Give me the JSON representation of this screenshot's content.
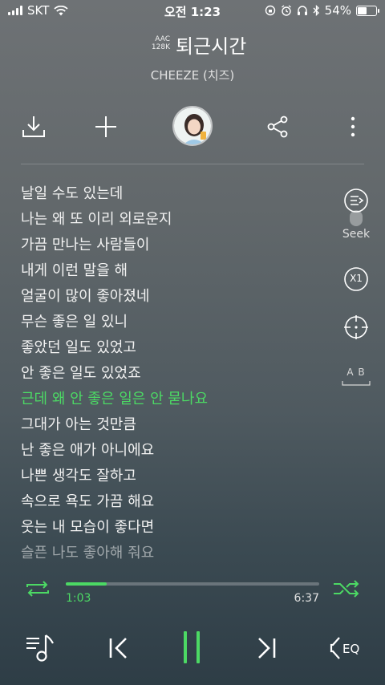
{
  "status_bar": {
    "carrier": "SKT",
    "time": "오전 1:23",
    "battery": "54%",
    "battery_level": 0.54
  },
  "header": {
    "quality_codec": "AAC",
    "quality_bitrate": "128K",
    "title": "퇴근시간",
    "artist": "CHEEZE (치즈)"
  },
  "actions": {
    "download_icon": "download-icon",
    "add_icon": "plus-icon",
    "share_icon": "share-icon",
    "more_icon": "more-vertical-icon"
  },
  "lyrics": [
    "날일 수도 있는데",
    "나는 왜 또 이리 외로운지",
    "가끔 만나는 사람들이",
    "내게 이런 말을 해",
    "얼굴이 많이 좋아졌네",
    "무슨 좋은 일 있니",
    "좋았던 일도 있었고",
    "안 좋은 일도 있었죠",
    "근데 왜 안 좋은 일은 안 묻나요",
    "그대가 아는 것만큼",
    "난 좋은 애가 아니에요",
    "나쁜 생각도 잘하고",
    "속으로 욕도 가끔 해요",
    "웃는 내 모습이 좋다면",
    "슬픈 나도 좋아해 줘요"
  ],
  "current_lyric_index": 8,
  "tools": {
    "seek_label": "Seek",
    "speed_label": "X1",
    "ab_label": "A B"
  },
  "progress": {
    "current": "1:03",
    "total": "6:37",
    "fraction": 0.16
  },
  "colors": {
    "accent": "#4cd964"
  }
}
